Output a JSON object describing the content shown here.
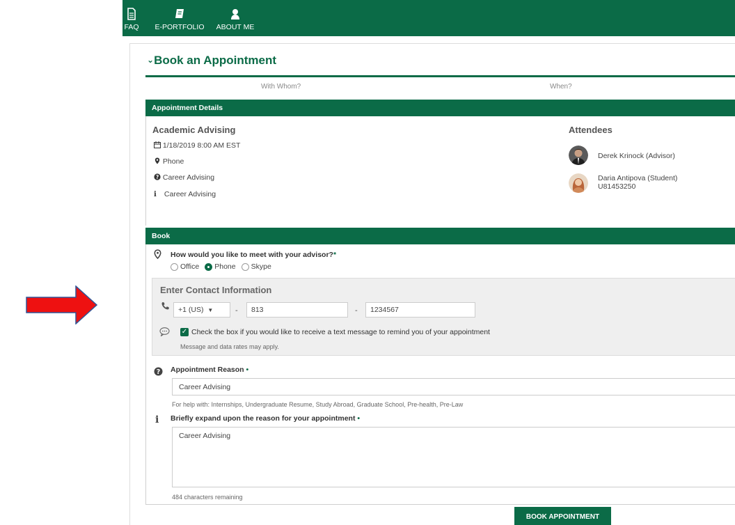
{
  "colors": {
    "brand_green": "#0b6b47",
    "arrow_red": "#ee1111",
    "arrow_border": "#2f5597",
    "panel_gray": "#efefef"
  },
  "nav": {
    "items": [
      {
        "label": "FAQ",
        "icon": "document-icon"
      },
      {
        "label": "E-PORTFOLIO",
        "icon": "book-icon"
      },
      {
        "label": "ABOUT ME",
        "icon": "user-icon"
      }
    ]
  },
  "page": {
    "title": "Book an Appointment",
    "steps": [
      "With Whom?",
      "When?"
    ]
  },
  "details": {
    "header": "Appointment Details",
    "title": "Academic Advising",
    "datetime": "1/18/2019 8:00 AM EST",
    "location": "Phone",
    "reason": "Career Advising",
    "info": "Career Advising",
    "attendees_title": "Attendees",
    "attendees": [
      {
        "name": "Derek Krinock (Advisor)",
        "id": ""
      },
      {
        "name": "Daria Antipova (Student)",
        "id": "U81453250"
      }
    ]
  },
  "book": {
    "header": "Book",
    "meet_question": "How would you like to meet with your advisor?",
    "required_mark": "*",
    "meet_options": [
      "Office",
      "Phone",
      "Skype"
    ],
    "meet_selected": "Phone",
    "contact_title": "Enter Contact Information",
    "country_code": "+1 (US)",
    "area_code": "813",
    "phone_number": "1234567",
    "dash": "-",
    "sms_label": "Check the box if you would like to receive a text message to remind you of your appointment",
    "sms_checked": true,
    "rates_note": "Message and data rates may apply.",
    "reason_label": "Appointment Reason",
    "required_dot": "•",
    "reason_value": "Career Advising",
    "reason_help": "For help with: Internships, Undergraduate Resume, Study Abroad, Graduate School, Pre-health, Pre-Law",
    "expand_label": "Briefly expand upon the reason for your appointment",
    "expand_value": "Career Advising",
    "chars_remaining": "484 characters remaining",
    "submit_label": "BOOK APPOINTMENT"
  }
}
